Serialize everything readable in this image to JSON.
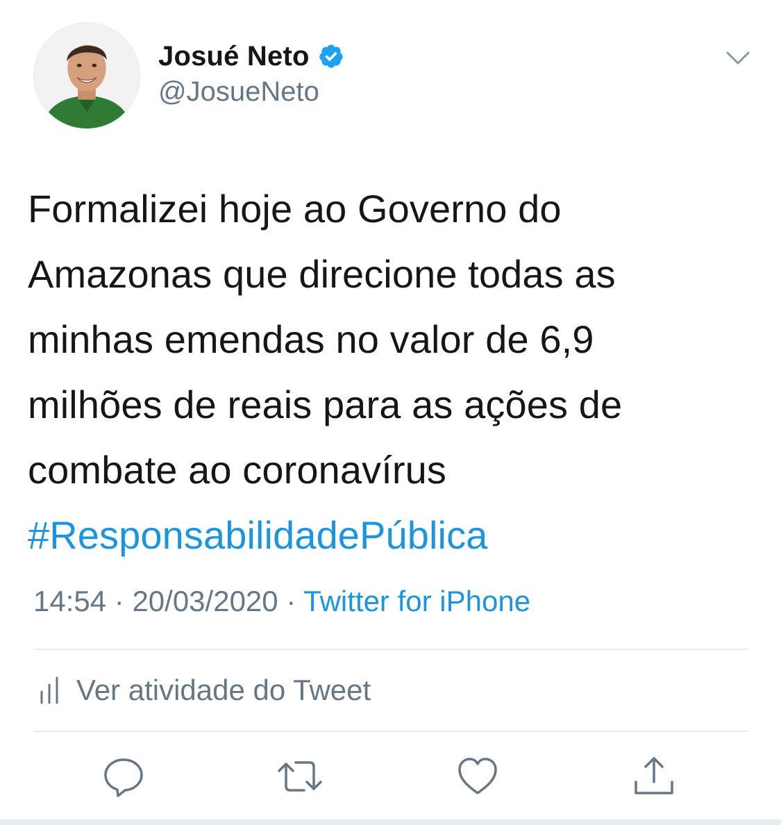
{
  "tweet": {
    "author": {
      "display_name": "Josué Neto",
      "handle": "@JosueNeto",
      "verified": true
    },
    "text_lines": [
      "Formalizei hoje ao Governo do",
      "Amazonas que direcione todas as",
      "minhas emendas no valor de 6,9",
      "milhões de reais para as ações de",
      "combate ao coronavírus"
    ],
    "hashtag": "#ResponsabilidadePública",
    "time": "14:54",
    "date": "20/03/2020",
    "source": "Twitter for iPhone",
    "separator": " · "
  },
  "activity": {
    "label": "Ver atividade do Tweet"
  },
  "colors": {
    "text": "#14171a",
    "secondary": "#657786",
    "accent": "#1b95e0",
    "divider": "#e6ecf0"
  },
  "icons": {
    "caret": "chevron-down-icon",
    "verified": "verified-badge-icon",
    "activity": "bar-chart-icon",
    "reply": "reply-icon",
    "retweet": "retweet-icon",
    "like": "heart-icon",
    "share": "share-icon"
  }
}
